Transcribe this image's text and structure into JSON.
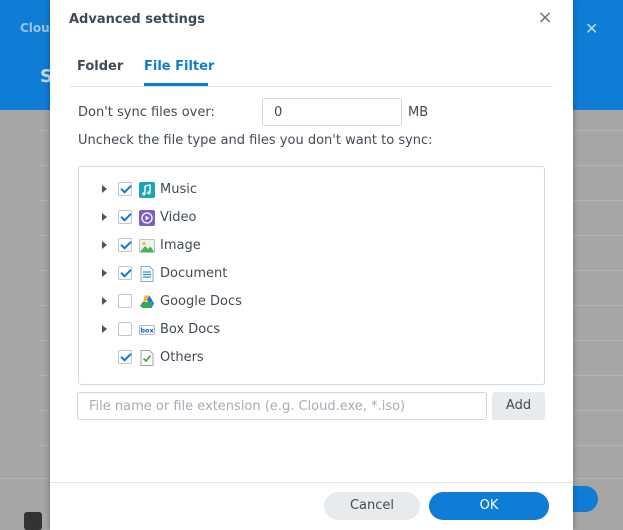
{
  "background": {
    "app_title": "Clou",
    "heading_initial": "S"
  },
  "dialog": {
    "title": "Advanced settings",
    "close_label": "×",
    "tabs": [
      {
        "label": "Folder",
        "active": false
      },
      {
        "label": "File Filter",
        "active": true
      }
    ],
    "size_limit": {
      "label": "Don't sync files over:",
      "value": "0",
      "unit": "MB"
    },
    "instruction": "Uncheck the file type and files you don't want to sync:",
    "file_types": [
      {
        "label": "Music",
        "checked": true,
        "expandable": true,
        "icon": "music-icon"
      },
      {
        "label": "Video",
        "checked": true,
        "expandable": true,
        "icon": "video-icon"
      },
      {
        "label": "Image",
        "checked": true,
        "expandable": true,
        "icon": "image-icon"
      },
      {
        "label": "Document",
        "checked": true,
        "expandable": true,
        "icon": "document-icon"
      },
      {
        "label": "Google Docs",
        "checked": false,
        "expandable": true,
        "icon": "google-drive-icon"
      },
      {
        "label": "Box Docs",
        "checked": false,
        "expandable": true,
        "icon": "box-icon"
      },
      {
        "label": "Others",
        "checked": true,
        "expandable": false,
        "icon": "others-icon"
      }
    ],
    "filter_input": {
      "value": "",
      "placeholder": "File name or file extension (e.g. Cloud.exe, *.iso)"
    },
    "add_label": "Add",
    "cancel_label": "Cancel",
    "ok_label": "OK"
  },
  "colors": {
    "accent": "#0f7cd6",
    "text": "#414b55"
  }
}
